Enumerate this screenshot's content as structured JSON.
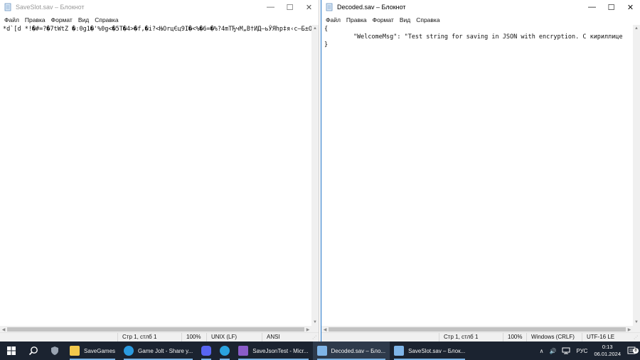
{
  "left_window": {
    "title": "SaveSlot.sav – Блокнот",
    "controls": {
      "minimize": "—",
      "maximize": "☐",
      "close": "✕"
    },
    "menu": [
      "Файл",
      "Правка",
      "Формат",
      "Вид",
      "Справка"
    ],
    "content": "*d`[d *!�#=?�7tWtZ �:0g1�'%0g<�5T�4>�f,�i?<ЊOrцЄц9I�<%�6=�%?4mTЂчM„В†ИД–ьЎЯhp‡я‹c–Б±O`у",
    "status": {
      "position": "Стр 1, стлб 1",
      "zoom": "100%",
      "line_ending": "UNIX (LF)",
      "encoding": "ANSI"
    }
  },
  "right_window": {
    "title": "Decoded.sav – Блокнот",
    "controls": {
      "minimize": "—",
      "maximize": "☐",
      "close": "✕"
    },
    "menu": [
      "Файл",
      "Правка",
      "Формат",
      "Вид",
      "Справка"
    ],
    "content": "{\n        \"WelcomeMsg\": \"Test string for saving in JSON with encryption. С кириллице\n}",
    "status": {
      "position": "Стр 1, стлб 1",
      "zoom": "100%",
      "line_ending": "Windows (CRLF)",
      "encoding": "UTF-16 LE"
    }
  },
  "taskbar": {
    "apps": [
      {
        "label": "SaveGames",
        "icon": "folder-icon",
        "color": "#f2c94c"
      },
      {
        "label": "Game Jolt - Share y...",
        "icon": "edge-icon",
        "color": "#2b9be0"
      },
      {
        "label": "",
        "icon": "discord-icon",
        "color": "#5865f2"
      },
      {
        "label": "",
        "icon": "telegram-icon",
        "color": "#2aa3e0"
      },
      {
        "label": "SaveJsonTest - Micr...",
        "icon": "visual-studio-icon",
        "color": "#8b5cc9"
      },
      {
        "label": "Decoded.sav – Бло...",
        "icon": "notepad-icon",
        "color": "#7fb5e8"
      },
      {
        "label": "SaveSlot.sav – Блок...",
        "icon": "notepad-icon",
        "color": "#7fb5e8"
      }
    ],
    "tray": {
      "chevron": "∧",
      "volume": "🔊",
      "language": "РУС",
      "notifications_count": "8"
    },
    "clock": {
      "time": "0:13",
      "date": "06.01.2024"
    }
  }
}
